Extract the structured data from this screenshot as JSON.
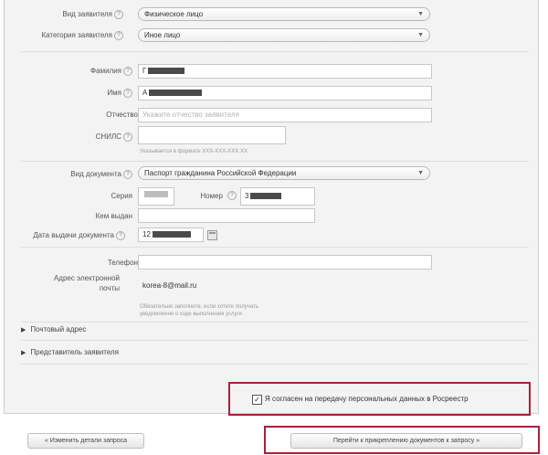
{
  "form": {
    "applicant_type": {
      "label": "Вид заявителя",
      "value": "Физическое лицо"
    },
    "applicant_category": {
      "label": "Категория заявителя",
      "value": "Иное лицо"
    },
    "surname": {
      "label": "Фамилия",
      "value": "Г"
    },
    "name": {
      "label": "Имя",
      "value": "А"
    },
    "patronymic": {
      "label": "Отчество",
      "placeholder": "Укажите отчество заявителя"
    },
    "snils": {
      "label": "СНИЛС",
      "hint": "Указывается в формате XXX-XXX-XXX XX"
    },
    "document_type": {
      "label": "Вид документа",
      "value": "Паспорт гражданина Российской Федерации"
    },
    "series": {
      "label": "Серия"
    },
    "number": {
      "label": "Номер",
      "value": "3"
    },
    "issued_by": {
      "label": "Кем выдан"
    },
    "issue_date": {
      "label": "Дата выдачи документа",
      "value": "12"
    },
    "phone": {
      "label": "Телефон"
    },
    "email": {
      "label": "Адрес электронной почты",
      "value": "korea-8@mail.ru",
      "hint": "Обязательно заполните, если хотите получать уведомления о ходе выполнения услуги"
    }
  },
  "sections": {
    "postal": "Почтовый адрес",
    "representative": "Представитель заявителя"
  },
  "consent": {
    "label": "Я согласен на передачу персональных данных в Росреестр",
    "checked": true
  },
  "buttons": {
    "back": "« Изменить детали запроса",
    "next": "Перейти к прикреплению документов к запросу »"
  }
}
